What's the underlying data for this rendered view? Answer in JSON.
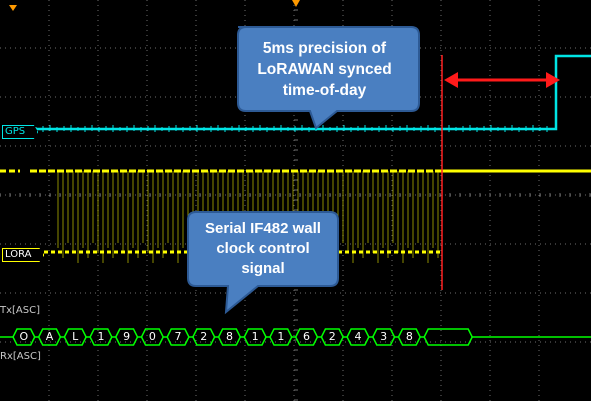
{
  "channels": {
    "gps": {
      "label": "GPS",
      "color": "#00e5e5"
    },
    "lora": {
      "label": "LORA",
      "color": "#ffff00"
    },
    "tx": {
      "label": "Tx[ASC]"
    },
    "rx": {
      "label": "Rx[ASC]"
    }
  },
  "serial_decode": {
    "bytes": [
      "O",
      "A",
      "L",
      "1",
      "9",
      "0",
      "7",
      "2",
      "8",
      "1",
      "1",
      "6",
      "2",
      "4",
      "3",
      "8"
    ],
    "color": "#00ff00"
  },
  "annotations": {
    "precision": {
      "lines": [
        "5ms precision of",
        "LoRAWAN synced",
        "time-of-day"
      ]
    },
    "serial": {
      "lines": [
        "Serial IF482 wall",
        "clock control",
        "signal"
      ]
    }
  },
  "colors": {
    "callout_fill": "#4a7fc1",
    "callout_border": "#2d5a95",
    "marker": "#ff2020",
    "grid": "#6e6e6e"
  }
}
